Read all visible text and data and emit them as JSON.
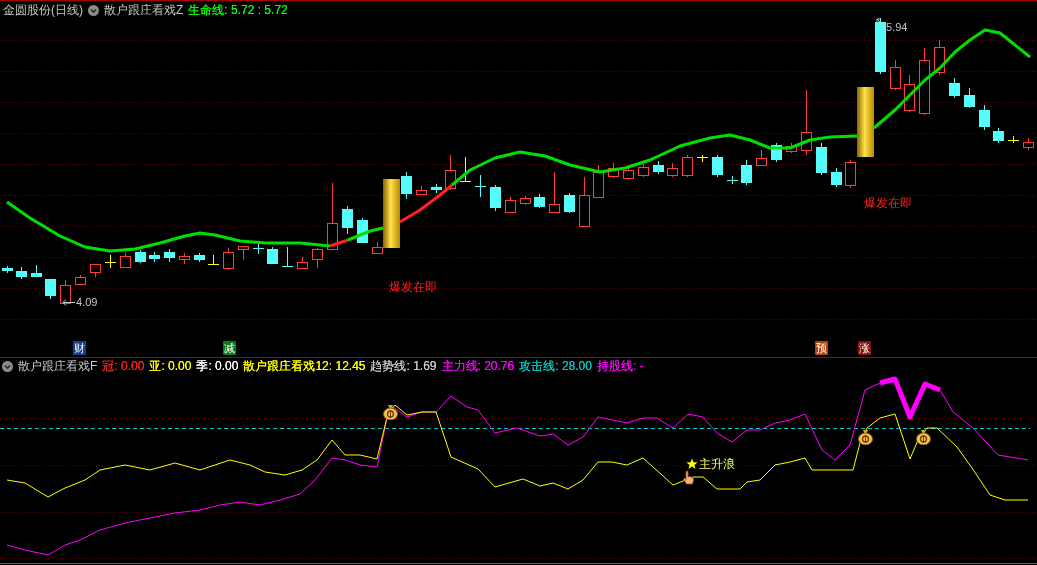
{
  "top_panel": {
    "title": "金圆股份(日线)",
    "indicator": "散户跟庄看戏Z",
    "legend": [
      {
        "text": "生命线: 5.72 : 5.72",
        "color": "#00ff00"
      }
    ],
    "price_labels": [
      {
        "kind": "high",
        "text": "5.94"
      },
      {
        "kind": "low",
        "text": "4.09"
      }
    ],
    "signals": [
      "爆发在即",
      "爆发在即"
    ],
    "markers": [
      {
        "text": "财",
        "color": "#1a3c8a"
      },
      {
        "text": "减",
        "color": "#0a7a1a"
      },
      {
        "text": "预",
        "color": "#b4400a"
      },
      {
        "text": "涨",
        "color": "#8a1010"
      }
    ]
  },
  "bottom_panel": {
    "indicator": "散户跟庄看戏F",
    "legend": [
      {
        "text": "冠: 0.00",
        "color": "#ff2020"
      },
      {
        "text": "亚: 0.00",
        "color": "#ffff00"
      },
      {
        "text": "季: 0.00",
        "color": "#ffffff"
      },
      {
        "text": "散户跟庄看戏12: 12.45",
        "color": "#ffff00"
      },
      {
        "text": "趋势线: 1.69",
        "color": "#c8c8c8"
      },
      {
        "text": "主力线: 20.76",
        "color": "#ff00ff"
      },
      {
        "text": "攻击线: 28.00",
        "color": "#00c8c8"
      },
      {
        "text": "持股线: -",
        "color": "#ff00ff"
      }
    ],
    "callout": "主升浪"
  }
}
